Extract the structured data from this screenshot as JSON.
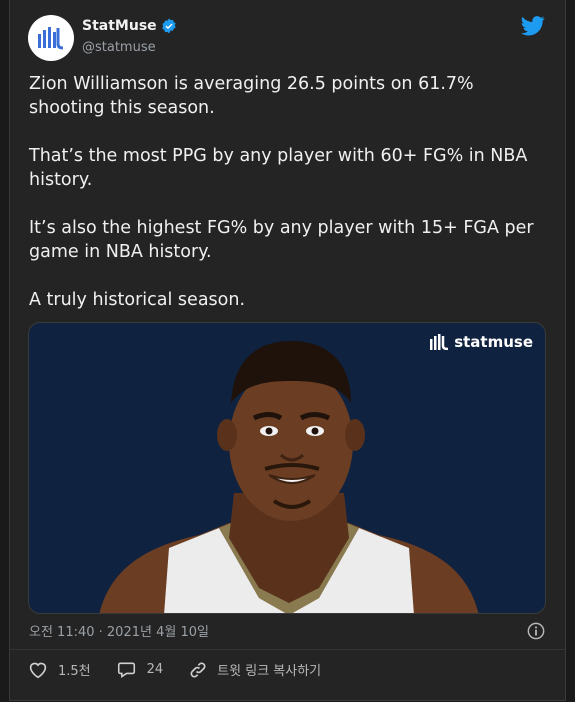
{
  "tweet": {
    "author_name": "StatMuse",
    "author_handle": "@statmuse",
    "verified": true,
    "paragraphs": [
      "Zion Williamson is averaging 26.5 points on 61.7% shooting this season.",
      "That’s the most PPG by any player with 60+ FG% in NBA history.",
      "It’s also the highest FG% by any player with 15+ FGA per game in NBA history.",
      "A truly historical season."
    ],
    "timestamp": "오전 11:40 · 2021년 4월 10일"
  },
  "media": {
    "watermark": "statmuse",
    "background_color": "#0f2240"
  },
  "actions": {
    "like_count": "1.5천",
    "reply_count": "24",
    "copy_link_label": "트윗 링크 복사하기"
  },
  "icons": {
    "twitter": "twitter-bird-icon",
    "verified": "verified-badge-icon",
    "info": "info-icon",
    "like": "heart-icon",
    "reply": "speech-bubble-icon",
    "link": "link-icon"
  },
  "colors": {
    "twitter_blue": "#1d9bf0",
    "background": "#242424"
  }
}
